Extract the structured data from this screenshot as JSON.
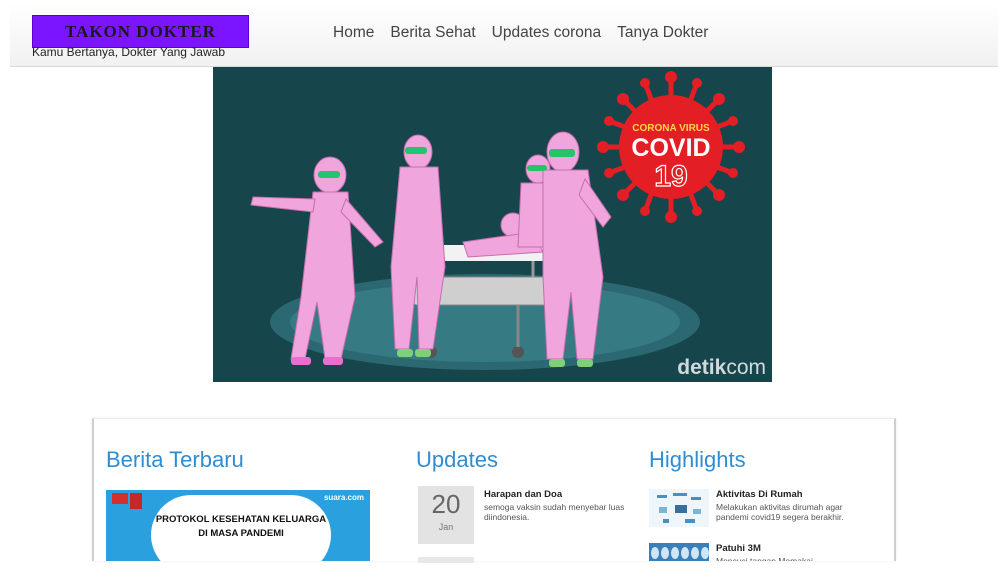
{
  "site": {
    "logo": "TAKON DOKTER",
    "tagline": "Kamu Bertanya, Dokter Yang Jawab"
  },
  "nav": {
    "items": [
      "Home",
      "Berita Sehat",
      "Updates corona",
      "Tanya Dokter"
    ]
  },
  "hero": {
    "badge_line1": "CORONA VIRUS",
    "badge_line2": "COVID",
    "badge_line3": "19",
    "watermark_bold": "detik",
    "watermark_thin": "com"
  },
  "sections": {
    "berita": {
      "title": "Berita Terbaru",
      "thumb_text_line1": "PROTOKOL KESEHATAN KELUARGA",
      "thumb_text_line2": "DI MASA PANDEMI",
      "thumb_source": "suara.com"
    },
    "updates": {
      "title": "Updates",
      "items": [
        {
          "day": "20",
          "month": "Jan",
          "title": "Harapan dan Doa",
          "desc": "semoga vaksin sudah menyebar luas diindonesia."
        }
      ]
    },
    "highlights": {
      "title": "Highlights",
      "items": [
        {
          "title": "Aktivitas Di Rumah",
          "desc": "Melakukan aktivitas dirumah agar pandemi covid19 segera berakhir."
        },
        {
          "title": "Patuhi 3M",
          "desc": "Mencuci tangan Memakai"
        }
      ]
    }
  },
  "colors": {
    "accent": "#2f8dd1",
    "logo_bg": "#7b14ff",
    "hero_bg": "#16454c",
    "suit": "#f0a5dc",
    "virus_red": "#e31e24"
  }
}
